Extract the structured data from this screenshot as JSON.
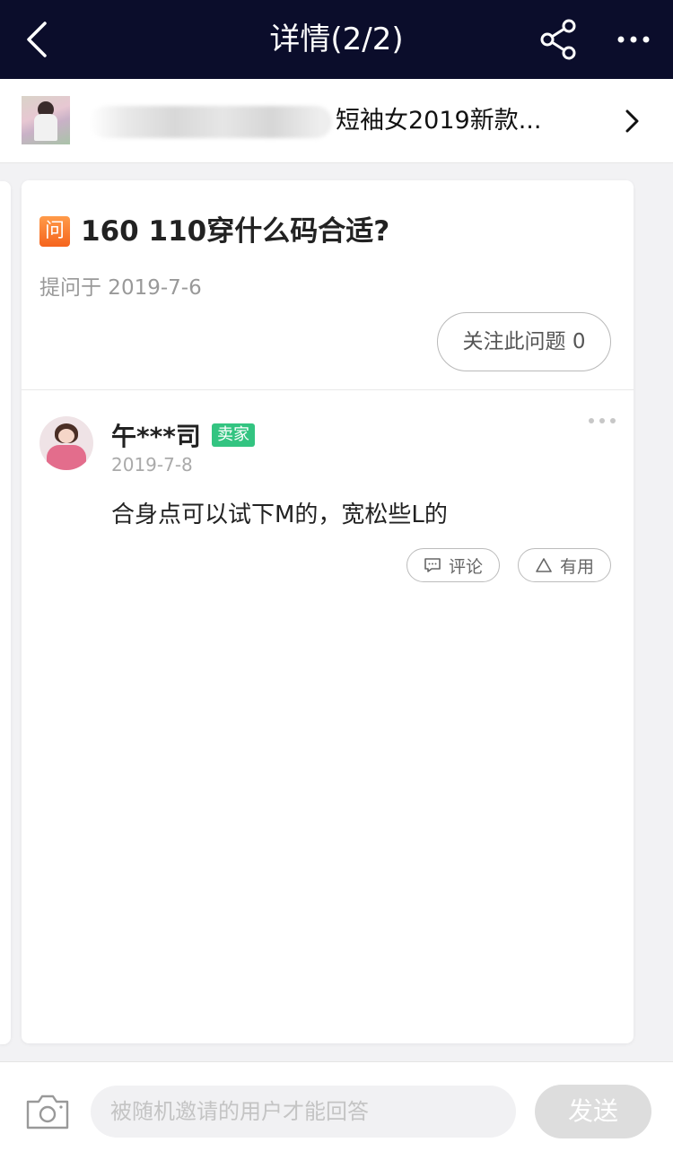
{
  "nav": {
    "title": "详情(2/2)",
    "back_icon": "chevron-left-icon",
    "share_icon": "share-icon",
    "more_icon": "more-horizontal-icon",
    "background": "#0b0d2b"
  },
  "product": {
    "title": "短袖女2019新款...",
    "chevron_icon": "chevron-right-icon"
  },
  "question": {
    "badge": "问",
    "title": "160 110穿什么码合适?",
    "date": "提问于 2019-7-6",
    "follow_label": "关注此问题 0"
  },
  "answer": {
    "user_name": "午***司",
    "badge": "卖家",
    "badge_color": "#33c481",
    "date": "2019-7-8",
    "text": "合身点可以试下M的，宽松些L的",
    "comment_label": "评论",
    "useful_label": "有用"
  },
  "bottom": {
    "input_placeholder": "被随机邀请的用户才能回答",
    "send_label": "发送",
    "camera_icon": "camera-icon"
  }
}
